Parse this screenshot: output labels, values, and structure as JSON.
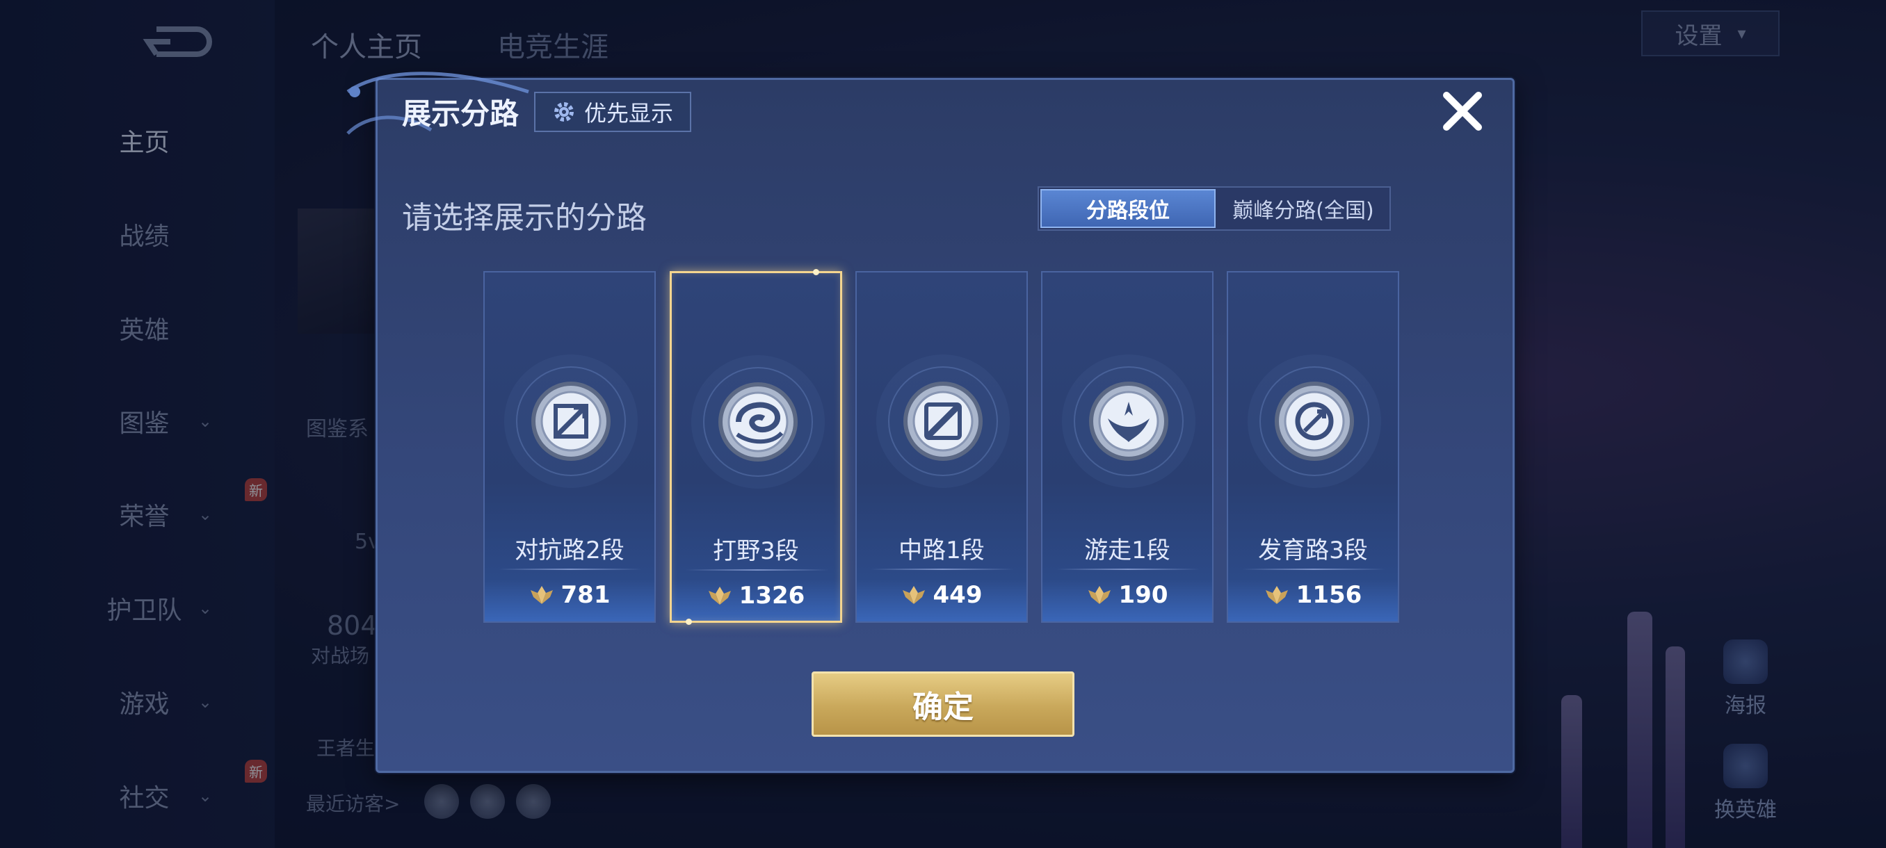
{
  "background": {
    "nav": [
      {
        "label": "主页",
        "chevron": false,
        "active": true
      },
      {
        "label": "战绩",
        "chevron": false
      },
      {
        "label": "英雄",
        "chevron": false
      },
      {
        "label": "图鉴",
        "chevron": true
      },
      {
        "label": "荣誉",
        "chevron": true,
        "badge": "新"
      },
      {
        "label": "护卫队",
        "chevron": true
      },
      {
        "label": "游戏",
        "chevron": true
      },
      {
        "label": "社交",
        "chevron": true,
        "badge": "新"
      }
    ],
    "tabs": [
      "个人主页",
      "电竞生涯"
    ],
    "settings_label": "设置",
    "fragments": {
      "tujian": "图鉴系",
      "small_5v": "5v",
      "count_804": "804",
      "battle": "对战场",
      "king": "王者生",
      "recent_visitors": "最近访客>"
    },
    "side_buttons": [
      "海报",
      "换英雄"
    ]
  },
  "modal": {
    "title": "展示分路",
    "priority_label": "优先显示",
    "subtitle": "请选择展示的分路",
    "segments": [
      {
        "label": "分路段位",
        "active": true
      },
      {
        "label": "巅峰分路(全国)",
        "active": false
      }
    ],
    "lanes": [
      {
        "name": "对抗路2段",
        "score": "781",
        "icon": "clash-lane-sword-emblem-icon",
        "selected": false
      },
      {
        "name": "打野3段",
        "score": "1326",
        "icon": "jungle-dragon-emblem-icon",
        "selected": true
      },
      {
        "name": "中路1段",
        "score": "449",
        "icon": "mid-lane-slash-emblem-icon",
        "selected": false
      },
      {
        "name": "游走1段",
        "score": "190",
        "icon": "roam-wings-emblem-icon",
        "selected": false
      },
      {
        "name": "发育路3段",
        "score": "1156",
        "icon": "farm-lane-arrow-emblem-icon",
        "selected": false
      }
    ],
    "confirm_label": "确定"
  },
  "colors": {
    "accent_gold": "#f4d58f",
    "button_gold": "#c9a85b",
    "active_segment": "#4a74c4",
    "modal_bg": "#34477a"
  }
}
